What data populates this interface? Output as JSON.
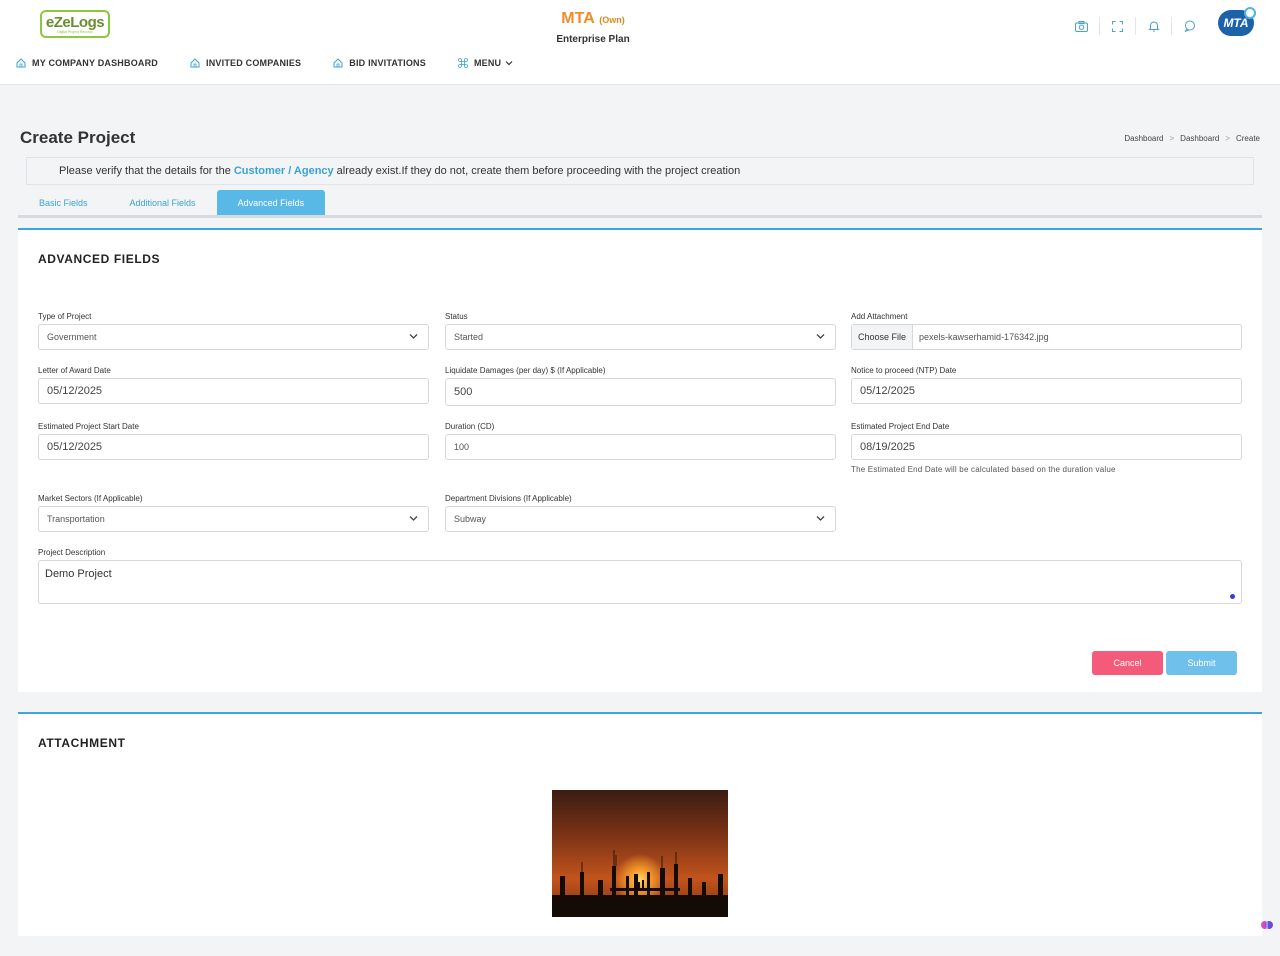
{
  "header": {
    "logo_text": "eZeLogs",
    "logo_tagline": "Digital Project Records",
    "company_name": "MTA",
    "company_tag": "(Own)",
    "plan": "Enterprise Plan",
    "avatar_text": "MTA",
    "icons": [
      "camera-icon",
      "fullscreen-icon",
      "bell-icon",
      "chat-icon"
    ]
  },
  "nav": {
    "items": [
      {
        "label": "MY COMPANY DASHBOARD",
        "icon": "home-icon"
      },
      {
        "label": "INVITED COMPANIES",
        "icon": "home-icon"
      },
      {
        "label": "BID INVITATIONS",
        "icon": "home-icon"
      },
      {
        "label": "MENU",
        "icon": "command-icon"
      }
    ]
  },
  "page": {
    "title": "Create Project",
    "breadcrumb": [
      "Dashboard",
      "Dashboard",
      "Create"
    ]
  },
  "notice": {
    "before": "Please verify that the details for the",
    "highlight": "Customer / Agency",
    "after": "already exist.If they do not, create them before proceeding with the project creation"
  },
  "tabs": [
    {
      "label": "Basic Fields",
      "active": false
    },
    {
      "label": "Additional Fields",
      "active": false
    },
    {
      "label": "Advanced Fields",
      "active": true
    }
  ],
  "advanced": {
    "title": "ADVANCED FIELDS",
    "type_of_project": {
      "label": "Type of Project",
      "value": "Government"
    },
    "status": {
      "label": "Status",
      "value": "Started"
    },
    "attachment": {
      "label": "Add Attachment",
      "button": "Choose File",
      "file": "pexels-kawserhamid-176342.jpg"
    },
    "letter_of_award": {
      "label": "Letter of Award Date",
      "value": "05/12/2025"
    },
    "liquidate_damages": {
      "label": "Liquidate Damages (per day) $ (If Applicable)",
      "value": "500"
    },
    "ntp_date": {
      "label": "Notice to proceed (NTP) Date",
      "value": "05/12/2025"
    },
    "est_start": {
      "label": "Estimated Project Start Date",
      "value": "05/12/2025"
    },
    "duration": {
      "label": "Duration (CD)",
      "value": "100"
    },
    "est_end": {
      "label": "Estimated Project End Date",
      "value": "08/19/2025",
      "hint": "The Estimated End Date will be calculated based on the duration value"
    },
    "market_sectors": {
      "label": "Market Sectors (If Applicable)",
      "value": "Transportation"
    },
    "department_divisions": {
      "label": "Department Divisions (If Applicable)",
      "value": "Subway"
    },
    "description": {
      "label": "Project Description",
      "value": "Demo Project"
    },
    "cancel_label": "Cancel",
    "submit_label": "Submit"
  },
  "attachment_section": {
    "title": "ATTACHMENT",
    "image_subject": "sunset-construction-site-photo"
  },
  "colors": {
    "accent": "#3aa8df",
    "tab_active": "#59b9e6",
    "cancel": "#f45b7a",
    "submit": "#6fc0ea",
    "company": "#f28c28"
  }
}
